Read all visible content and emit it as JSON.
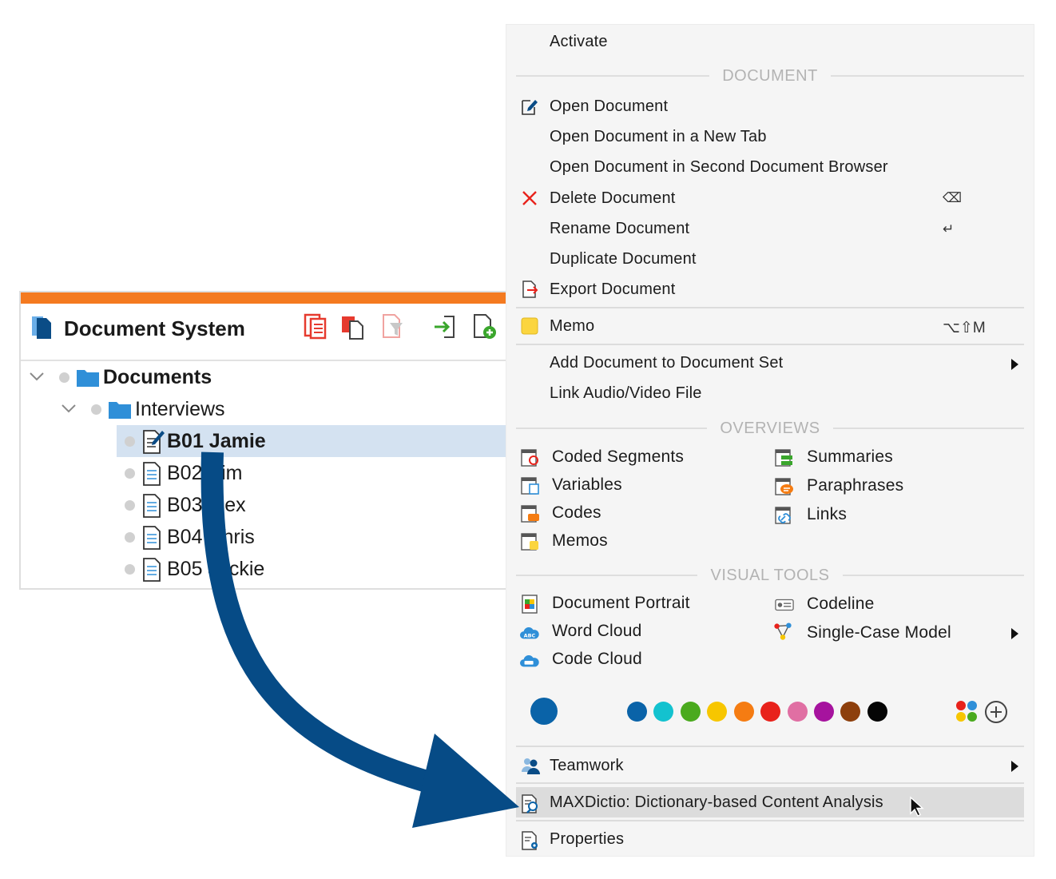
{
  "doc_system": {
    "title": "Document System",
    "tree": [
      {
        "label": "Documents",
        "level": 0,
        "bold": true,
        "type": "folder"
      },
      {
        "label": "Interviews",
        "level": 1,
        "bold": false,
        "type": "folder"
      },
      {
        "label": "B01 Jamie",
        "level": 2,
        "bold": true,
        "type": "doc-edit",
        "selected": true
      },
      {
        "label": "B02 Kim",
        "level": 2,
        "bold": false,
        "type": "doc"
      },
      {
        "label": "B03 Alex",
        "level": 2,
        "bold": false,
        "type": "doc"
      },
      {
        "label": "B04 Chris",
        "level": 2,
        "bold": false,
        "type": "doc"
      },
      {
        "label": "B05 Jackie",
        "level": 2,
        "bold": false,
        "type": "doc"
      }
    ],
    "toolbar_icons": [
      "paste-icon",
      "copy-icon",
      "filter-doc-icon",
      "import-icon",
      "new-document-icon"
    ],
    "accent_color": "#f47a20"
  },
  "menu": {
    "activate": "Activate",
    "document_header": "DOCUMENT",
    "open_document": "Open Document",
    "open_new_tab": "Open Document in a New Tab",
    "open_second_browser": "Open Document in Second Document Browser",
    "delete_document": "Delete Document",
    "delete_shortcut": "⌫",
    "rename_document": "Rename Document",
    "rename_shortcut": "↵",
    "duplicate_document": "Duplicate Document",
    "export_document": "Export Document",
    "memo": "Memo",
    "memo_shortcut": "⌥⇧M",
    "add_to_set": "Add Document to Document Set",
    "link_av": "Link Audio/Video File",
    "overviews_header": "OVERVIEWS",
    "overviews": {
      "coded_segments": "Coded Segments",
      "variables": "Variables",
      "codes": "Codes",
      "memos": "Memos",
      "summaries": "Summaries",
      "paraphrases": "Paraphrases",
      "links": "Links"
    },
    "visual_tools_header": "VISUAL TOOLS",
    "visual_tools": {
      "document_portrait": "Document Portrait",
      "word_cloud": "Word Cloud",
      "code_cloud": "Code Cloud",
      "codeline": "Codeline",
      "single_case_model": "Single-Case Model"
    },
    "current_color": "#0a63a8",
    "colors": [
      "#0a63a8",
      "#13c2cf",
      "#4aaa1e",
      "#f7c600",
      "#f57c12",
      "#e8221b",
      "#e06fa3",
      "#a6139e",
      "#8d3f0c",
      "#050505"
    ],
    "teamwork": "Teamwork",
    "maxdictio": "MAXDictio: Dictionary-based Content Analysis",
    "properties": "Properties"
  },
  "arrow_color": "#064b86"
}
